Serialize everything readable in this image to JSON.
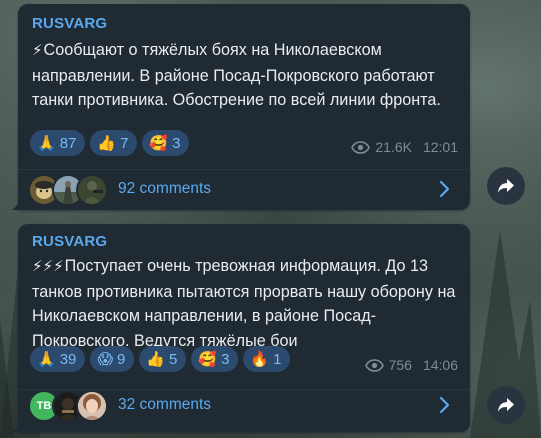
{
  "posts": [
    {
      "sender": "RUSVARG",
      "lead_emoji": "⚡",
      "text": "Сообщают о тяжёлых боях на Николаевском направлении. В районе Посад-Покровского работают танки противника. Обострение по всей линии фронта.",
      "reactions": [
        {
          "emoji": "🙏",
          "count": "87"
        },
        {
          "emoji": "👍",
          "count": "7"
        },
        {
          "emoji": "🥰",
          "count": "3"
        }
      ],
      "views": "21.6K",
      "time": "12:01",
      "comments_label": "92 comments"
    },
    {
      "sender": "RUSVARG",
      "lead_emoji": "⚡⚡⚡",
      "text": "Поступает очень тревожная информация. До 13 танков противника пытаются прорвать нашу оборону на Николаевском направлении, в районе Посад-Покровского. Ведутся тяжёлые бои",
      "reactions": [
        {
          "emoji": "🙏",
          "count": "39"
        },
        {
          "emoji": "😱",
          "count": "9"
        },
        {
          "emoji": "👍",
          "count": "5"
        },
        {
          "emoji": "🥰",
          "count": "3"
        },
        {
          "emoji": "🔥",
          "count": "1"
        }
      ],
      "views": "756",
      "time": "14:06",
      "comments_label": "32 comments",
      "commenter_initials": "ТВ"
    }
  ],
  "colors": {
    "bubble": "#1f2a33",
    "accent": "#5aa9ef",
    "reaction_bg": "#2b4a6e",
    "meta": "#7f8b95"
  },
  "icons": [
    "eye-icon",
    "chevron-right-icon",
    "share-arrow-icon"
  ]
}
